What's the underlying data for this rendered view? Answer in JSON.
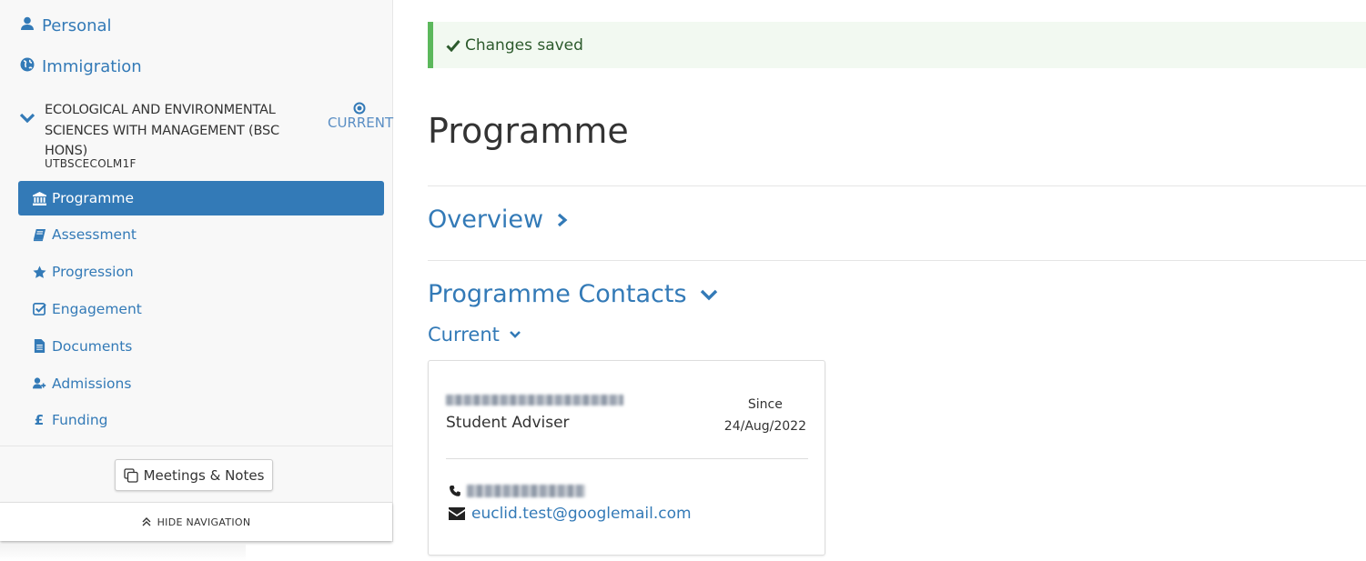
{
  "sidebar": {
    "top_items": [
      {
        "label": "Personal",
        "icon": "user-icon"
      },
      {
        "label": "Immigration",
        "icon": "globe-icon"
      }
    ],
    "programme": {
      "title": "ECOLOGICAL AND ENVIRONMENTAL SCIENCES WITH MANAGEMENT (BSC HONS)",
      "code": "UTBSCECOLM1F",
      "status_label": "CURRENT"
    },
    "sub_items": [
      {
        "label": "Programme",
        "icon": "institution-icon",
        "active": true
      },
      {
        "label": "Assessment",
        "icon": "book-icon"
      },
      {
        "label": "Progression",
        "icon": "star-icon"
      },
      {
        "label": "Engagement",
        "icon": "check-square-icon"
      },
      {
        "label": "Documents",
        "icon": "file-text-icon"
      },
      {
        "label": "Admissions",
        "icon": "user-plus-icon"
      },
      {
        "label": "Funding",
        "icon": "pound-icon",
        "glyph": "£"
      }
    ],
    "meetings_button": "Meetings & Notes",
    "hide_navigation": "HIDE NAVIGATION"
  },
  "main": {
    "alert": "Changes saved",
    "page_title": "Programme",
    "overview_label": "Overview",
    "contacts_label": "Programme Contacts",
    "current_label": "Current",
    "contact_card": {
      "role": "Student Adviser",
      "since_label": "Since",
      "since_date": "24/Aug/2022",
      "email": "euclid.test@googlemail.com"
    }
  },
  "colors": {
    "accent": "#337ab7",
    "success": "#5cb85c",
    "alert_bg": "#f2f9f1"
  }
}
